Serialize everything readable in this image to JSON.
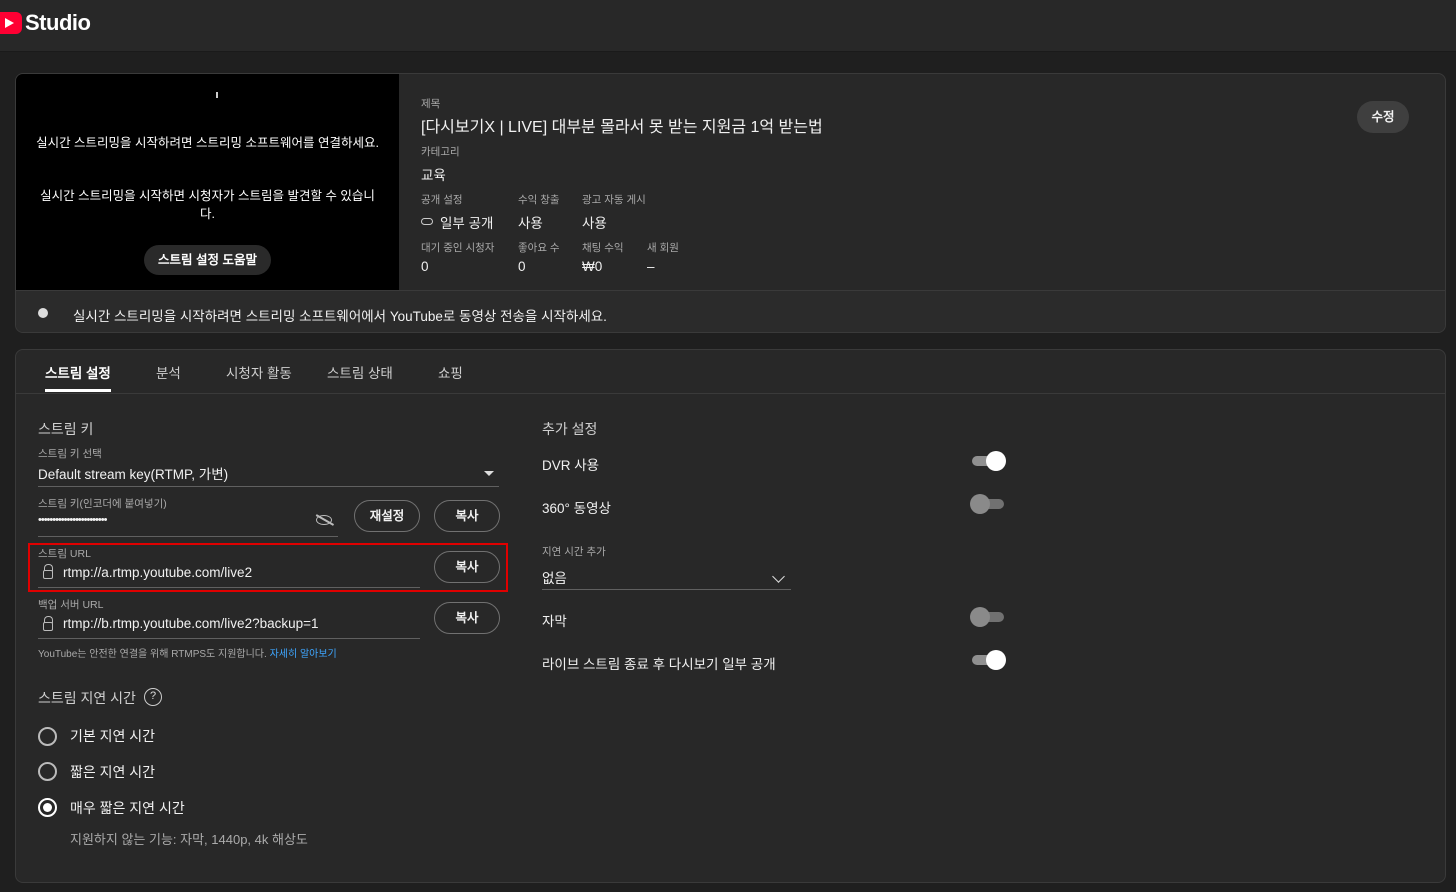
{
  "header": {
    "logo_text": "Studio"
  },
  "preview": {
    "message1": "실시간 스트리밍을 시작하려면 스트리밍 소프트웨어를 연결하세요.",
    "message2": "실시간 스트리밍을 시작하면 시청자가 스트림을 발견할 수 있습니다.",
    "help_button": "스트림 설정 도움말"
  },
  "details": {
    "title_label": "제목",
    "title": "[다시보기X | LIVE] 대부분 몰라서 못 받는 지원금 1억 받는법",
    "category_label": "카테고리",
    "category": "교육",
    "visibility_label": "공개 설정",
    "visibility": "일부 공개",
    "monetization_label": "수익 창출",
    "monetization": "사용",
    "auto_ads_label": "광고 자동 게시",
    "auto_ads": "사용",
    "waiting_label": "대기 중인 시청자",
    "waiting": "0",
    "likes_label": "좋아요 수",
    "likes": "0",
    "chat_revenue_label": "채팅 수익",
    "chat_revenue": "₩0",
    "new_members_label": "새 회원",
    "new_members": "–",
    "edit_button": "수정"
  },
  "status": {
    "text": "실시간 스트리밍을 시작하려면 스트리밍 소프트웨어에서 YouTube로 동영상 전송을 시작하세요."
  },
  "tabs": [
    "스트림 설정",
    "분석",
    "시청자 활동",
    "스트림 상태",
    "쇼핑"
  ],
  "stream_key": {
    "section_title": "스트림 키",
    "select_label": "스트림 키 선택",
    "select_value": "Default stream key(RTMP, 가변)",
    "key_label": "스트림 키(인코더에 붙여넣기)",
    "key_value": "••••••••••••••••••••••••",
    "reset_button": "재설정",
    "copy_button": "복사",
    "url_label": "스트림 URL",
    "url_value": "rtmp://a.rtmp.youtube.com/live2",
    "backup_label": "백업 서버 URL",
    "backup_value": "rtmp://b.rtmp.youtube.com/live2?backup=1",
    "rtmps_note": "YouTube는 안전한 연결을 위해 RTMPS도 지원합니다.",
    "learn_more": "자세히 알아보기"
  },
  "latency": {
    "section_title": "스트림 지연 시간",
    "options": [
      "기본 지연 시간",
      "짧은 지연 시간",
      "매우 짧은 지연 시간"
    ],
    "selected": 2,
    "note": "지원하지 않는 기능: 자막, 1440p, 4k 해상도"
  },
  "additional": {
    "section_title": "추가 설정",
    "dvr_label": "DVR 사용",
    "dvr_on": true,
    "video360_label": "360° 동영상",
    "video360_on": false,
    "delay_label": "지연 시간 추가",
    "delay_value": "없음",
    "captions_label": "자막",
    "captions_on": false,
    "unlisted_replay_label": "라이브 스트림 종료 후 다시보기 일부 공개",
    "unlisted_replay_on": true
  }
}
